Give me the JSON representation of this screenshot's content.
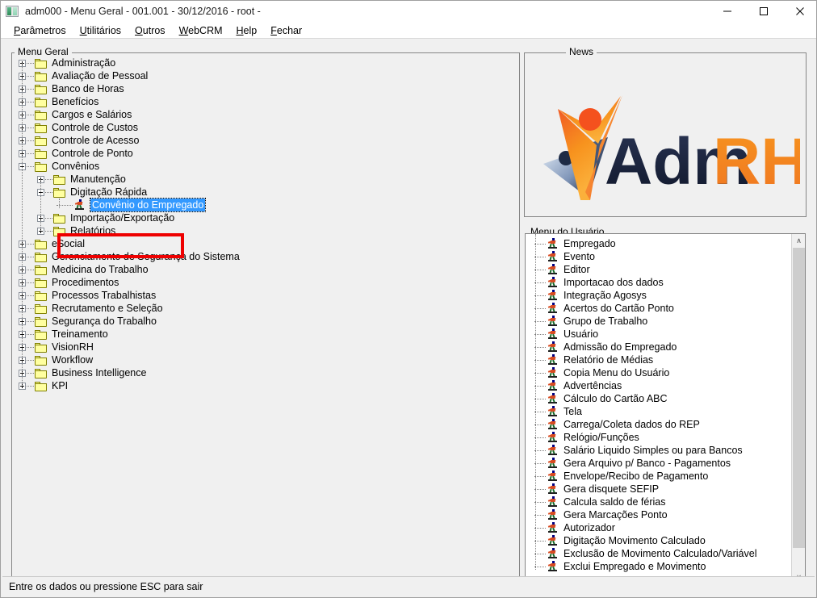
{
  "window": {
    "title": "adm000 - Menu Geral - 001.001 - 30/12/2016 - root -",
    "icon": "app-icon",
    "minimize": "—",
    "maximize": "□",
    "close": "✕"
  },
  "menubar": {
    "items": [
      {
        "label": "Parâmetros",
        "accel": "P"
      },
      {
        "label": "Utilitários",
        "accel": "U"
      },
      {
        "label": "Outros",
        "accel": "O"
      },
      {
        "label": "WebCRM",
        "accel": "W"
      },
      {
        "label": "Help",
        "accel": "H"
      },
      {
        "label": "Fechar",
        "accel": "F"
      }
    ]
  },
  "tree_panel": {
    "title": "Menu Geral",
    "nodes": [
      {
        "label": "Administração",
        "level": 0,
        "type": "folder",
        "state": "collapsed"
      },
      {
        "label": "Avaliação de Pessoal",
        "level": 0,
        "type": "folder",
        "state": "collapsed"
      },
      {
        "label": "Banco de Horas",
        "level": 0,
        "type": "folder",
        "state": "collapsed"
      },
      {
        "label": "Benefícios",
        "level": 0,
        "type": "folder",
        "state": "collapsed"
      },
      {
        "label": "Cargos e Salários",
        "level": 0,
        "type": "folder",
        "state": "collapsed"
      },
      {
        "label": "Controle de Custos",
        "level": 0,
        "type": "folder",
        "state": "collapsed"
      },
      {
        "label": "Controle de Acesso",
        "level": 0,
        "type": "folder",
        "state": "collapsed"
      },
      {
        "label": "Controle de Ponto",
        "level": 0,
        "type": "folder",
        "state": "collapsed"
      },
      {
        "label": "Convênios",
        "level": 0,
        "type": "folder",
        "state": "expanded"
      },
      {
        "label": "Manutenção",
        "level": 1,
        "type": "folder",
        "state": "collapsed"
      },
      {
        "label": "Digitação Rápida",
        "level": 1,
        "type": "folder",
        "state": "expanded"
      },
      {
        "label": "Convênio do Empregado",
        "level": 2,
        "type": "item",
        "state": "selected"
      },
      {
        "label": "Importação/Exportação",
        "level": 1,
        "type": "folder",
        "state": "collapsed"
      },
      {
        "label": "Relatórios",
        "level": 1,
        "type": "folder",
        "state": "collapsed"
      },
      {
        "label": "eSocial",
        "level": 0,
        "type": "folder",
        "state": "collapsed"
      },
      {
        "label": "Gerenciamento de Segurança do Sistema",
        "level": 0,
        "type": "folder",
        "state": "collapsed"
      },
      {
        "label": "Medicina do Trabalho",
        "level": 0,
        "type": "folder",
        "state": "collapsed"
      },
      {
        "label": "Procedimentos",
        "level": 0,
        "type": "folder",
        "state": "collapsed"
      },
      {
        "label": "Processos Trabalhistas",
        "level": 0,
        "type": "folder",
        "state": "collapsed"
      },
      {
        "label": "Recrutamento e Seleção",
        "level": 0,
        "type": "folder",
        "state": "collapsed"
      },
      {
        "label": "Segurança do Trabalho",
        "level": 0,
        "type": "folder",
        "state": "collapsed"
      },
      {
        "label": "Treinamento",
        "level": 0,
        "type": "folder",
        "state": "collapsed"
      },
      {
        "label": "VisionRH",
        "level": 0,
        "type": "folder",
        "state": "collapsed"
      },
      {
        "label": "Workflow",
        "level": 0,
        "type": "folder",
        "state": "collapsed"
      },
      {
        "label": "Business Intelligence",
        "level": 0,
        "type": "folder",
        "state": "collapsed"
      },
      {
        "label": "KPI",
        "level": 0,
        "type": "folder",
        "state": "collapsed"
      }
    ],
    "selected": "Convênio do Empregado",
    "highlight_color": "#ee0000",
    "selection_color": "#3399ff"
  },
  "news_panel": {
    "title": "News",
    "logo": {
      "name": "admrh-logo",
      "text_dark": "Adm",
      "text_accent": "RH",
      "dark_color": "#1b2440",
      "accent_color": "#f5821f",
      "orange_color": "#f26522",
      "blue_color": "#3d4f73"
    }
  },
  "user_menu": {
    "title": "Menu do Usuário",
    "items": [
      "Empregado",
      "Evento",
      "Editor",
      "Importacao dos dados",
      "Integração Agosys",
      "Acertos do Cartão Ponto",
      "Grupo de Trabalho",
      "Usuário",
      "Admissão do Empregado",
      "Relatório de Médias",
      "Copia Menu do Usuário",
      "Advertências",
      "Cálculo do Cartão ABC",
      "Tela",
      "Carrega/Coleta dados do REP",
      "Relógio/Funções",
      "Salário Liquido Simples ou para Bancos",
      "Gera Arquivo p/ Banco - Pagamentos",
      "Envelope/Recibo de Pagamento",
      "Gera disquete SEFIP",
      "Calcula saldo de férias",
      "Gera Marcações Ponto",
      "Autorizador",
      "Digitação Movimento Calculado",
      "Exclusão de Movimento Calculado/Variável",
      "Exclui Empregado e Movimento"
    ],
    "scrollbar": {
      "up": "∧",
      "down": "∨"
    }
  },
  "statusbar": {
    "message": "Entre os dados ou pressione ESC para sair"
  }
}
